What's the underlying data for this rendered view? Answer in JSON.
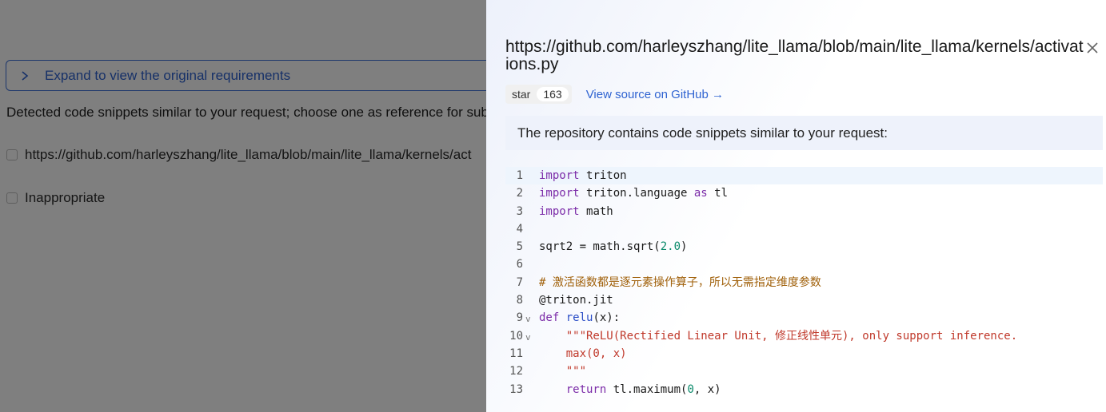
{
  "background": {
    "expand_label": "Expand to view the original requirements",
    "detected_text": "Detected code snippets similar to your request; choose one as reference for sub",
    "options": [
      "https://github.com/harleyszhang/lite_llama/blob/main/lite_llama/kernels/act",
      "Inappropriate"
    ]
  },
  "drawer": {
    "title": "https://github.com/harleyszhang/lite_llama/blob/main/lite_llama/kernels/activations.py",
    "star_label": "star",
    "star_count": "163",
    "source_link": "View source on GitHub →",
    "notice": "The repository contains code snippets similar to your request:",
    "code_lines": [
      {
        "n": "1",
        "fold": "",
        "parts": [
          [
            "kw",
            "import"
          ],
          [
            "",
            "triton"
          ]
        ]
      },
      {
        "n": "2",
        "fold": "",
        "parts": [
          [
            "kw",
            "import"
          ],
          [
            "",
            "triton.language "
          ],
          [
            "kw",
            "as"
          ],
          [
            "",
            " tl"
          ]
        ]
      },
      {
        "n": "3",
        "fold": "",
        "parts": [
          [
            "kw",
            "import"
          ],
          [
            "",
            "math"
          ]
        ]
      },
      {
        "n": "4",
        "fold": "",
        "parts": []
      },
      {
        "n": "5",
        "fold": "",
        "parts": [
          [
            "",
            "sqrt2 = math.sqrt("
          ],
          [
            "num",
            "2.0"
          ],
          [
            "",
            ")"
          ]
        ]
      },
      {
        "n": "6",
        "fold": "",
        "parts": []
      },
      {
        "n": "7",
        "fold": "",
        "parts": [
          [
            "cm",
            "# 激活函数都是逐元素操作算子，所以无需指定维度参数"
          ]
        ]
      },
      {
        "n": "8",
        "fold": "",
        "parts": [
          [
            "",
            "@triton.jit"
          ]
        ]
      },
      {
        "n": "9",
        "fold": "v",
        "parts": [
          [
            "kw",
            "def"
          ],
          [
            "fn",
            " relu"
          ],
          [
            "",
            "(x):"
          ]
        ]
      },
      {
        "n": "10",
        "fold": "v",
        "parts": [
          [
            "st",
            "    \"\"\"ReLU(Rectified Linear Unit, 修正线性单元), only support inference."
          ]
        ]
      },
      {
        "n": "11",
        "fold": "",
        "parts": [
          [
            "st",
            "    max(0, x)"
          ]
        ]
      },
      {
        "n": "12",
        "fold": "",
        "parts": [
          [
            "st",
            "    \"\"\""
          ]
        ]
      },
      {
        "n": "13",
        "fold": "",
        "parts": [
          [
            "kw",
            "    return"
          ],
          [
            "",
            " tl.maximum("
          ],
          [
            "num",
            "0"
          ],
          [
            "",
            ", x)"
          ]
        ]
      }
    ]
  },
  "icons": {
    "expand": "chevron-right-icon",
    "close": "close-icon"
  },
  "colors": {
    "accent": "#2f63d1",
    "keyword": "#7b2ba8",
    "comment": "#a0600a",
    "string": "#c0392b",
    "number": "#0a8a6a"
  }
}
